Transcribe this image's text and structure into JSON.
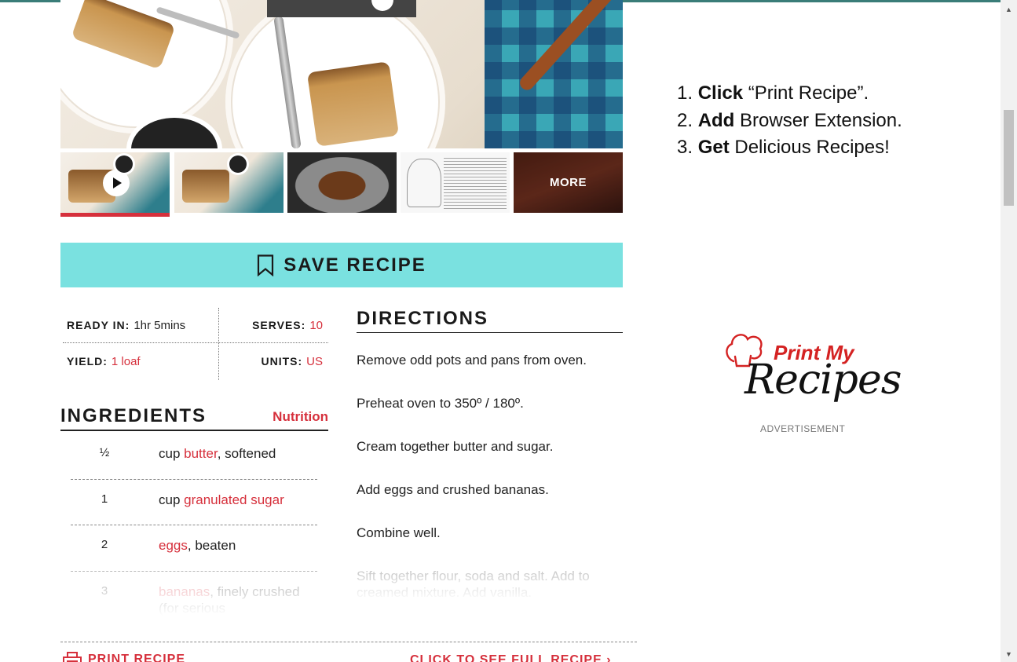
{
  "gallery": {
    "more_label": "MORE"
  },
  "save": {
    "label": "SAVE RECIPE"
  },
  "meta": {
    "ready_in_label": "READY IN:",
    "ready_in_value": "1hr 5mins",
    "serves_label": "SERVES:",
    "serves_value": "10",
    "yield_label": "YIELD:",
    "yield_value": "1 loaf",
    "units_label": "UNITS:",
    "units_value": "US"
  },
  "ingredients": {
    "title": "INGREDIENTS",
    "nutrition_link": "Nutrition",
    "items": [
      {
        "qty": "½",
        "pre": "cup ",
        "link": "butter",
        "post": ", softened"
      },
      {
        "qty": "1",
        "pre": "cup ",
        "link": "granulated sugar",
        "post": ""
      },
      {
        "qty": "2",
        "pre": "",
        "link": "eggs",
        "post": ", beaten"
      },
      {
        "qty": "3",
        "pre": "",
        "link": "bananas",
        "post": ", finely crushed (for serious"
      }
    ]
  },
  "directions": {
    "title": "DIRECTIONS",
    "steps": [
      "Remove odd pots and pans from oven.",
      "Preheat oven to 350º / 180º.",
      "Cream together butter and sugar.",
      "Add eggs and crushed bananas.",
      "Combine well.",
      "Sift together flour, soda and salt. Add to creamed mixture. Add vanilla."
    ]
  },
  "footer": {
    "print_label": "PRINT RECIPE",
    "full_recipe_label": "CLICK TO SEE FULL RECIPE ›"
  },
  "ad": {
    "step1_bold": "Click",
    "step1_rest": " “Print Recipe”.",
    "step2_bold": "Add",
    "step2_rest": " Browser Extension.",
    "step3_bold": "Get",
    "step3_rest": " Delicious Recipes!",
    "logo_top": "Print My",
    "logo_bottom": "Recipes",
    "label": "ADVERTISEMENT"
  },
  "colors": {
    "accent_red": "#d6303c",
    "save_bg": "#7ae1e0",
    "top_rule": "#3a7d78"
  },
  "icons": {
    "bookmark": "bookmark-icon",
    "play": "play-icon",
    "print": "printer-icon",
    "chef_hat": "chef-hat-icon"
  }
}
